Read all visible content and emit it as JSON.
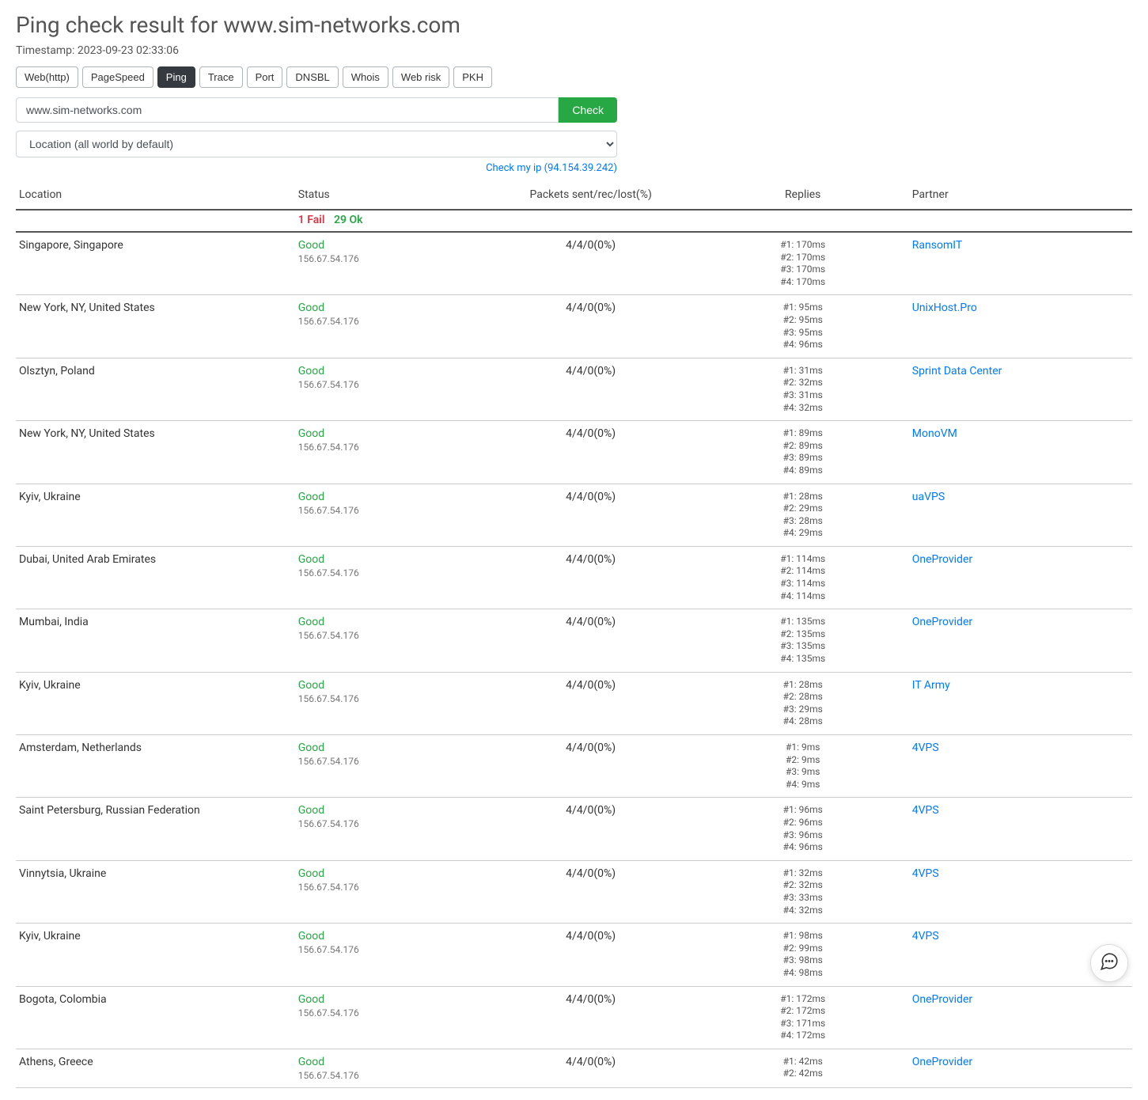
{
  "title": "Ping check result for www.sim-networks.com",
  "timestamp": "Timestamp: 2023-09-23 02:33:06",
  "tabs": [
    "Web(http)",
    "PageSpeed",
    "Ping",
    "Trace",
    "Port",
    "DNSBL",
    "Whois",
    "Web risk",
    "PKH"
  ],
  "active_tab": "Ping",
  "host_value": "www.sim-networks.com",
  "check_label": "Check",
  "location_placeholder": "Location (all world by default)",
  "check_my_ip": "Check my ip (94.154.39.242)",
  "headers": {
    "location": "Location",
    "status": "Status",
    "packets": "Packets sent/rec/lost(%)",
    "replies": "Replies",
    "partner": "Partner"
  },
  "summary": {
    "fail": "1 Fail",
    "ok": "29 Ok"
  },
  "default_ip": "156.67.54.176",
  "rows": [
    {
      "location": "Singapore, Singapore",
      "status": "Good",
      "packets": "4/4/0(0%)",
      "replies": [
        "#1: 170ms",
        "#2: 170ms",
        "#3: 170ms",
        "#4: 170ms"
      ],
      "partner": "RansomIT"
    },
    {
      "location": "New York, NY, United States",
      "status": "Good",
      "packets": "4/4/0(0%)",
      "replies": [
        "#1: 95ms",
        "#2: 95ms",
        "#3: 95ms",
        "#4: 96ms"
      ],
      "partner": "UnixHost.Pro"
    },
    {
      "location": "Olsztyn, Poland",
      "status": "Good",
      "packets": "4/4/0(0%)",
      "replies": [
        "#1: 31ms",
        "#2: 32ms",
        "#3: 31ms",
        "#4: 32ms"
      ],
      "partner": "Sprint Data Center"
    },
    {
      "location": "New York, NY, United States",
      "status": "Good",
      "packets": "4/4/0(0%)",
      "replies": [
        "#1: 89ms",
        "#2: 89ms",
        "#3: 89ms",
        "#4: 89ms"
      ],
      "partner": "MonoVM"
    },
    {
      "location": "Kyiv, Ukraine",
      "status": "Good",
      "packets": "4/4/0(0%)",
      "replies": [
        "#1: 28ms",
        "#2: 29ms",
        "#3: 28ms",
        "#4: 29ms"
      ],
      "partner": "uaVPS"
    },
    {
      "location": "Dubai, United Arab Emirates",
      "status": "Good",
      "packets": "4/4/0(0%)",
      "replies": [
        "#1: 114ms",
        "#2: 114ms",
        "#3: 114ms",
        "#4: 114ms"
      ],
      "partner": "OneProvider"
    },
    {
      "location": "Mumbai, India",
      "status": "Good",
      "packets": "4/4/0(0%)",
      "replies": [
        "#1: 135ms",
        "#2: 135ms",
        "#3: 135ms",
        "#4: 135ms"
      ],
      "partner": "OneProvider"
    },
    {
      "location": "Kyiv, Ukraine",
      "status": "Good",
      "packets": "4/4/0(0%)",
      "replies": [
        "#1: 28ms",
        "#2: 28ms",
        "#3: 29ms",
        "#4: 28ms"
      ],
      "partner": "IT Army"
    },
    {
      "location": "Amsterdam, Netherlands",
      "status": "Good",
      "packets": "4/4/0(0%)",
      "replies": [
        "#1: 9ms",
        "#2: 9ms",
        "#3: 9ms",
        "#4: 9ms"
      ],
      "partner": "4VPS"
    },
    {
      "location": "Saint Petersburg, Russian Federation",
      "status": "Good",
      "packets": "4/4/0(0%)",
      "replies": [
        "#1: 96ms",
        "#2: 96ms",
        "#3: 96ms",
        "#4: 96ms"
      ],
      "partner": "4VPS"
    },
    {
      "location": "Vinnytsia, Ukraine",
      "status": "Good",
      "packets": "4/4/0(0%)",
      "replies": [
        "#1: 32ms",
        "#2: 32ms",
        "#3: 33ms",
        "#4: 32ms"
      ],
      "partner": "4VPS"
    },
    {
      "location": "Kyiv, Ukraine",
      "status": "Good",
      "packets": "4/4/0(0%)",
      "replies": [
        "#1: 98ms",
        "#2: 99ms",
        "#3: 98ms",
        "#4: 98ms"
      ],
      "partner": "4VPS"
    },
    {
      "location": "Bogota, Colombia",
      "status": "Good",
      "packets": "4/4/0(0%)",
      "replies": [
        "#1: 172ms",
        "#2: 172ms",
        "#3: 171ms",
        "#4: 172ms"
      ],
      "partner": "OneProvider"
    },
    {
      "location": "Athens, Greece",
      "status": "Good",
      "packets": "4/4/0(0%)",
      "replies": [
        "#1: 42ms",
        "#2: 42ms"
      ],
      "partner": "OneProvider"
    }
  ]
}
